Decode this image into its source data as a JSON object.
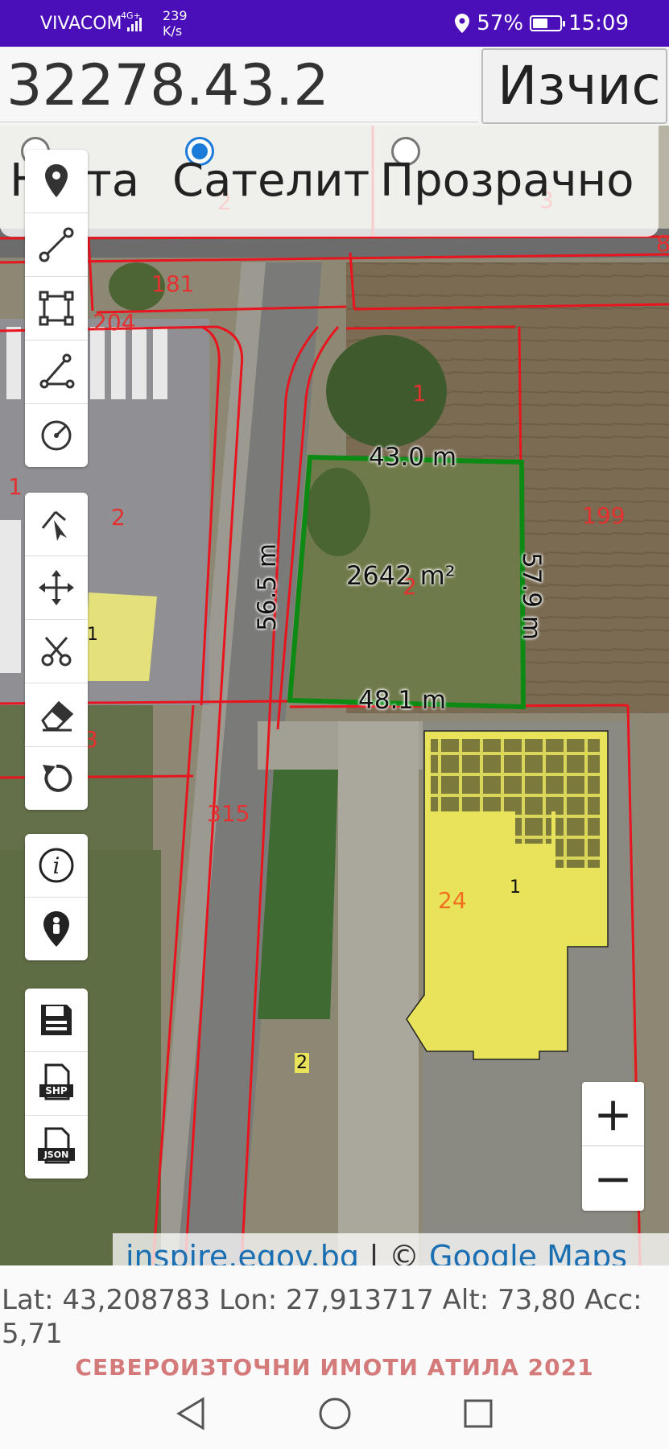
{
  "status_bar": {
    "carrier": "VIVACOM",
    "network": "4G+",
    "speed_value": "239",
    "speed_unit": "K/s",
    "battery": "57%",
    "battery_level": 0.57,
    "time": "15:09"
  },
  "search": {
    "value": "32278.43.2",
    "button_label": "Изчис"
  },
  "layers": {
    "options": [
      "Карта",
      "Сателит",
      "Прозрачно"
    ],
    "selected": "Сателит",
    "first_visible_text": "Н    ота"
  },
  "map": {
    "parcel_numbers": [
      "2",
      "3",
      "181",
      "204",
      "1",
      "1",
      "2",
      "199",
      "2",
      "1",
      "3",
      "315",
      "1",
      "24",
      "2",
      "8"
    ],
    "measurements": {
      "top": "43.0 m",
      "left": "56.5 m",
      "right": "57.9 m",
      "bottom": "48.1 m",
      "area": "2642 m²"
    },
    "colors": {
      "cadastre_lines": "#e8141e",
      "selected_parcel": "#0c8a14",
      "building_fill": "#e8e35a"
    }
  },
  "toolbar": {
    "group1": [
      "location-pin-icon",
      "line-tool-icon",
      "polygon-tool-icon",
      "angle-tool-icon",
      "circle-tool-icon"
    ],
    "group2": [
      "select-pointer-icon",
      "move-icon",
      "cut-icon",
      "eraser-icon",
      "undo-icon"
    ],
    "group3": [
      "info-icon",
      "my-location-icon"
    ],
    "group4": [
      "save-icon",
      "shp-export-icon",
      "json-export-icon"
    ],
    "shp_label": "SHP",
    "json_label": "JSON"
  },
  "zoom": {
    "in": "+",
    "out": "−"
  },
  "attribution": {
    "source1": "inspire.egov.bg",
    "separator": " | © ",
    "source2": "Google Maps"
  },
  "gps": {
    "text": "Lat: 43,208783 Lon: 27,913717 Alt: 73,80 Acc: 5,71"
  },
  "footer": {
    "title": "СЕВЕРОИЗТОЧНИ ИМОТИ АТИЛА 2021"
  }
}
